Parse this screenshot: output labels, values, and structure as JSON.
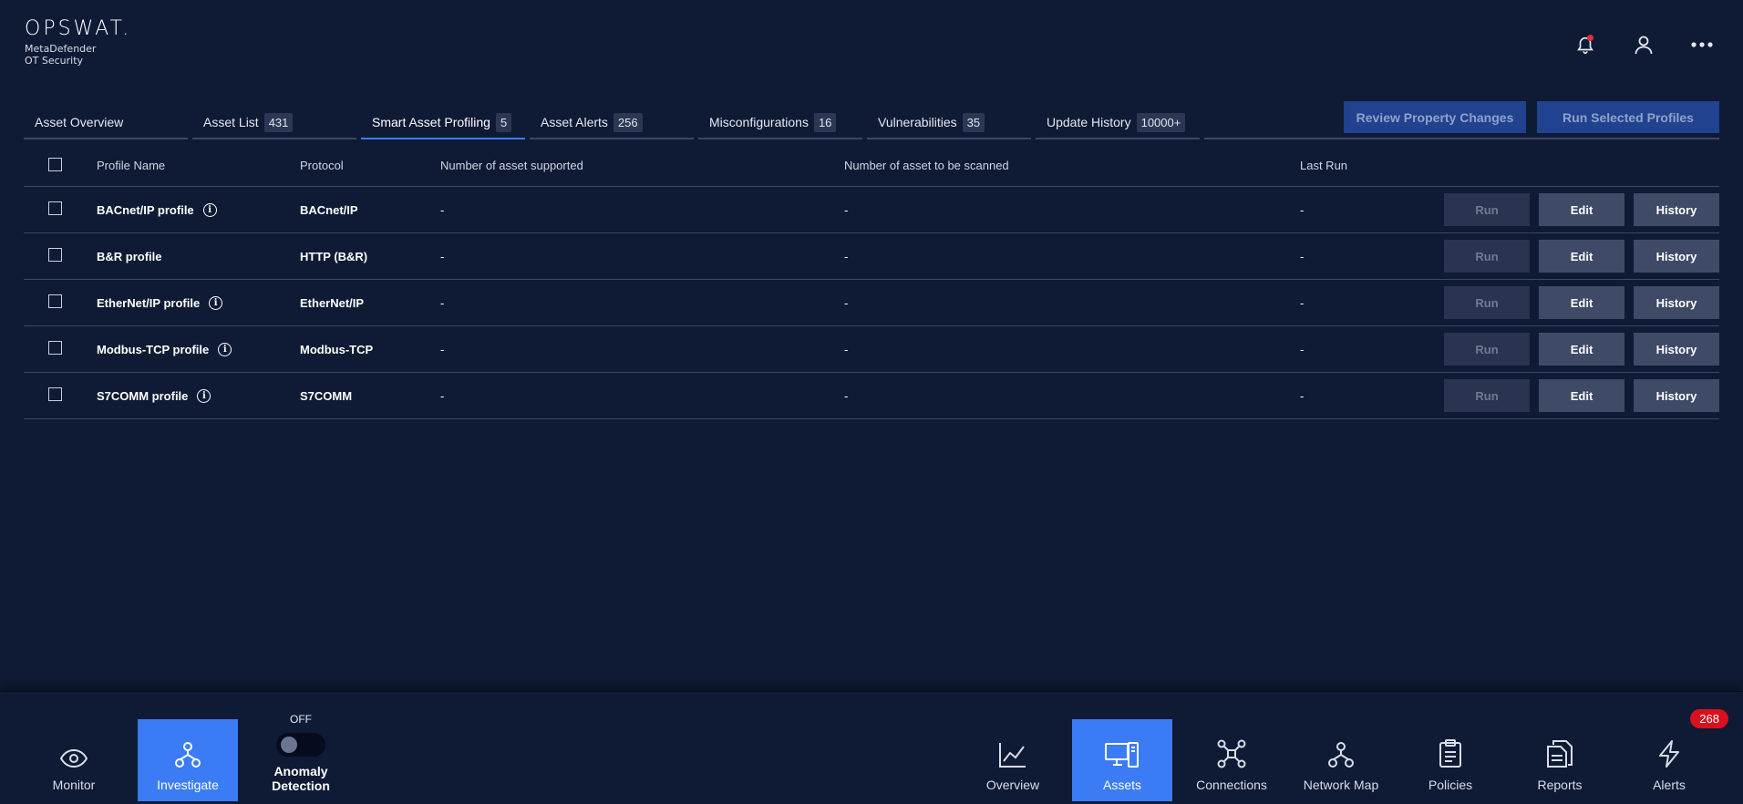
{
  "brand": {
    "logo": "OPSWAT.",
    "line1": "MetaDefender",
    "line2": "OT Security"
  },
  "header_icons": [
    "bell-icon",
    "user-icon",
    "more-icon"
  ],
  "tabs": [
    {
      "label": "Asset Overview",
      "count": ""
    },
    {
      "label": "Asset List",
      "count": "431"
    },
    {
      "label": "Smart Asset Profiling",
      "count": "5"
    },
    {
      "label": "Asset Alerts",
      "count": "256"
    },
    {
      "label": "Misconfigurations",
      "count": "16"
    },
    {
      "label": "Vulnerabilities",
      "count": "35"
    },
    {
      "label": "Update History",
      "count": "10000+"
    }
  ],
  "actions": {
    "review": "Review Property Changes",
    "run_selected": "Run Selected Profiles"
  },
  "columns": {
    "name": "Profile Name",
    "protocol": "Protocol",
    "supported": "Number of asset supported",
    "scanned": "Number of asset to be scanned",
    "last_run": "Last Run"
  },
  "rows": [
    {
      "name": "BACnet/IP profile",
      "protocol": "BACnet/IP",
      "supported": "-",
      "scanned": "-",
      "last_run": "-"
    },
    {
      "name": "B&R profile",
      "protocol": "HTTP (B&R)",
      "supported": "-",
      "scanned": "-",
      "last_run": "-"
    },
    {
      "name": "EtherNet/IP profile",
      "protocol": "EtherNet/IP",
      "supported": "-",
      "scanned": "-",
      "last_run": "-"
    },
    {
      "name": "Modbus-TCP profile",
      "protocol": "Modbus-TCP",
      "supported": "-",
      "scanned": "-",
      "last_run": "-"
    },
    {
      "name": "S7COMM profile",
      "protocol": "S7COMM",
      "supported": "-",
      "scanned": "-",
      "last_run": "-"
    }
  ],
  "row_buttons": {
    "run": "Run",
    "edit": "Edit",
    "history": "History"
  },
  "bottom_left": {
    "monitor": "Monitor",
    "investigate": "Investigate"
  },
  "anomaly": {
    "state": "OFF",
    "label": "Anomaly Detection"
  },
  "bottom_right": {
    "overview": "Overview",
    "assets": "Assets",
    "connections": "Connections",
    "network_map": "Network Map",
    "policies": "Policies",
    "reports": "Reports",
    "alerts": "Alerts"
  },
  "alert_count": "268",
  "colors": {
    "background": "#0f1a35",
    "accent": "#3b7cf5",
    "alert": "#d9101d"
  }
}
